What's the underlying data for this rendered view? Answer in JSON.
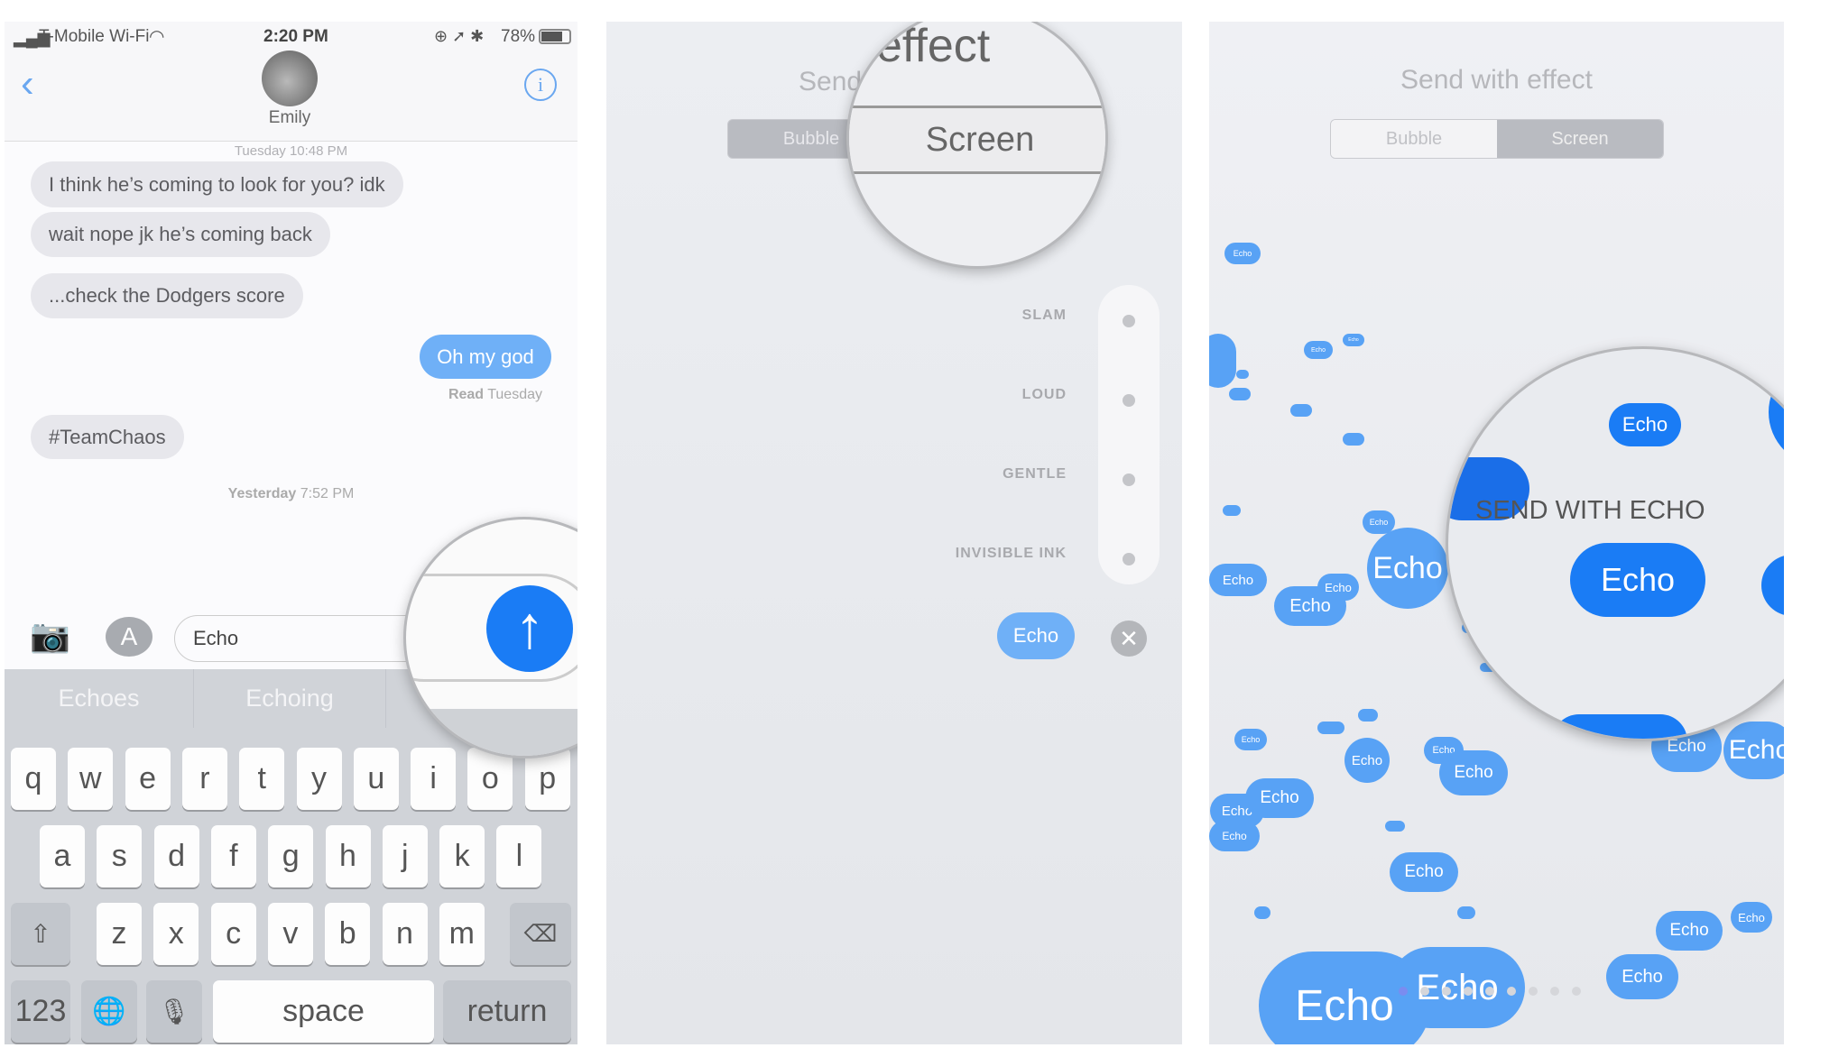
{
  "status": {
    "carrier": "T-Mobile Wi-Fi",
    "time": "2:20 PM",
    "battery": "78%"
  },
  "contact": {
    "name": "Emily",
    "partial_timestamp": "Tuesday 10:48 PM"
  },
  "messages": [
    {
      "from": "them",
      "text": "I think he’s coming to look for you? idk"
    },
    {
      "from": "them",
      "text": "wait nope jk he’s coming back"
    },
    {
      "from": "them",
      "text": "...check the Dodgers score"
    },
    {
      "from": "me",
      "text": "Oh my god"
    },
    {
      "from": "them",
      "text": "#TeamChaos"
    }
  ],
  "read_receipt": {
    "label": "Read",
    "day": "Tuesday"
  },
  "timestamp": {
    "day": "Yesterday",
    "time": "7:52 PM"
  },
  "composer": {
    "value": "Echo"
  },
  "predictions": [
    "Echoes",
    "Echoing",
    ""
  ],
  "keyboard": {
    "row1": [
      "q",
      "w",
      "e",
      "r",
      "t",
      "y",
      "u",
      "i",
      "o",
      "p"
    ],
    "row2": [
      "a",
      "s",
      "d",
      "f",
      "g",
      "h",
      "j",
      "k",
      "l"
    ],
    "row3": [
      "z",
      "x",
      "c",
      "v",
      "b",
      "n",
      "m"
    ],
    "numbers": "123",
    "space": "space",
    "return": "return"
  },
  "effects": {
    "title": "Send with effect",
    "title_partial": "Send",
    "magnified_title": "effect",
    "tabs": [
      "Bubble",
      "Screen"
    ],
    "selected_tab": "Screen",
    "bubble_effects": [
      "SLAM",
      "LOUD",
      "GENTLE",
      "INVISIBLE INK"
    ],
    "message": "Echo"
  },
  "screen_effect": {
    "title": "Send with effect",
    "tabs": [
      "Bubble",
      "Screen"
    ],
    "selected_tab": "Screen",
    "send_label": "SEND WITH ECHO",
    "bubble_text": "Echo",
    "page_count": 9,
    "current_page": 0
  },
  "colors": {
    "accent": "#1a7cf5",
    "bubble_blue": "#58a2f5",
    "bubble_gray": "#e7e7ec"
  }
}
